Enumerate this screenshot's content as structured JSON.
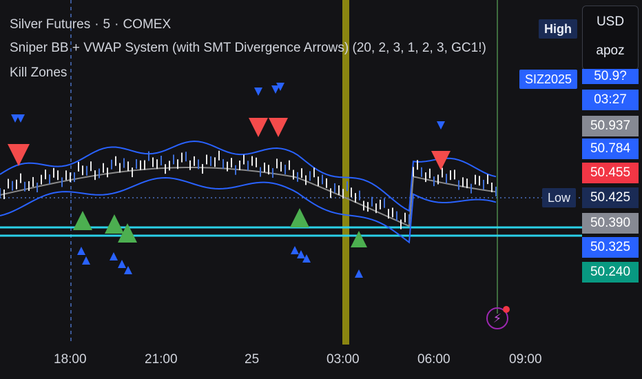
{
  "legend": {
    "symbol": "Silver Futures",
    "interval": "5",
    "exchange": "COMEX",
    "sep": "·",
    "indicator": "Sniper BB + VWAP System (with SMT Divergence Arrows) (20, 2, 3, 1, 2, 3, GC1!)",
    "killzones": "Kill Zones"
  },
  "tags": {
    "high": "High",
    "low": "Low",
    "symbol_tag": "SIZ2025"
  },
  "currency": {
    "code": "USD",
    "user": "apoz"
  },
  "price_labels": [
    {
      "text": "50.9?",
      "bg": "#2962ff"
    },
    {
      "text": "03:27",
      "bg": "#2962ff"
    },
    {
      "text": "50.937",
      "bg": "#868993"
    },
    {
      "text": "50.784",
      "bg": "#2962ff"
    },
    {
      "text": "50.455",
      "bg": "#f23645"
    },
    {
      "text": "50.425",
      "bg": "#1a2b55"
    },
    {
      "text": "50.390",
      "bg": "#868993"
    },
    {
      "text": "50.325",
      "bg": "#2962ff"
    },
    {
      "text": "50.240",
      "bg": "#089981"
    }
  ],
  "x_axis": [
    "18:00",
    "21:00",
    "25",
    "03:00",
    "06:00",
    "09:00"
  ],
  "colors": {
    "bg": "#131316",
    "band": "#2962ff",
    "vwap": "#8a8a8a",
    "cyan": "#2ad0e8",
    "up": "#4caf50",
    "down": "#f44b4b",
    "smt": "#2962ff",
    "kill": "#a09a10",
    "vline": "#4c8a4c"
  },
  "icons": {
    "alert": "lightning-icon"
  }
}
